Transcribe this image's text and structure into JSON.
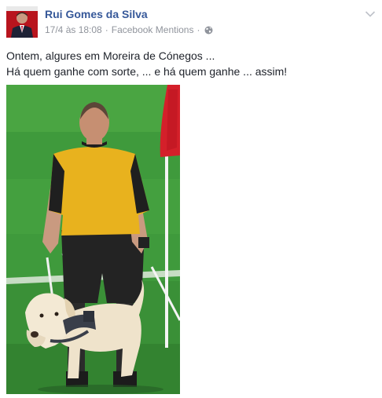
{
  "post": {
    "author": "Rui Gomes da Silva",
    "timestamp": "17/4 às 18:08",
    "separator": "·",
    "source": "Facebook Mentions",
    "privacy_icon": "globe-icon",
    "menu_icon": "chevron-down-icon",
    "text_lines": [
      "Ontem, algures em Moreira de Cónegos ...",
      "Há quem ganhe com sorte, ... e há quem ganhe ... assim!"
    ],
    "photo": {
      "subject": "referee with guide dog",
      "icon": "photo-image"
    }
  },
  "colors": {
    "author_link": "#365899",
    "meta_gray": "#90949c",
    "text": "#1d2129",
    "pitch_green": "#3f9a3c",
    "jersey_yellow": "#e8b21e",
    "flag_red": "#d4202a"
  }
}
